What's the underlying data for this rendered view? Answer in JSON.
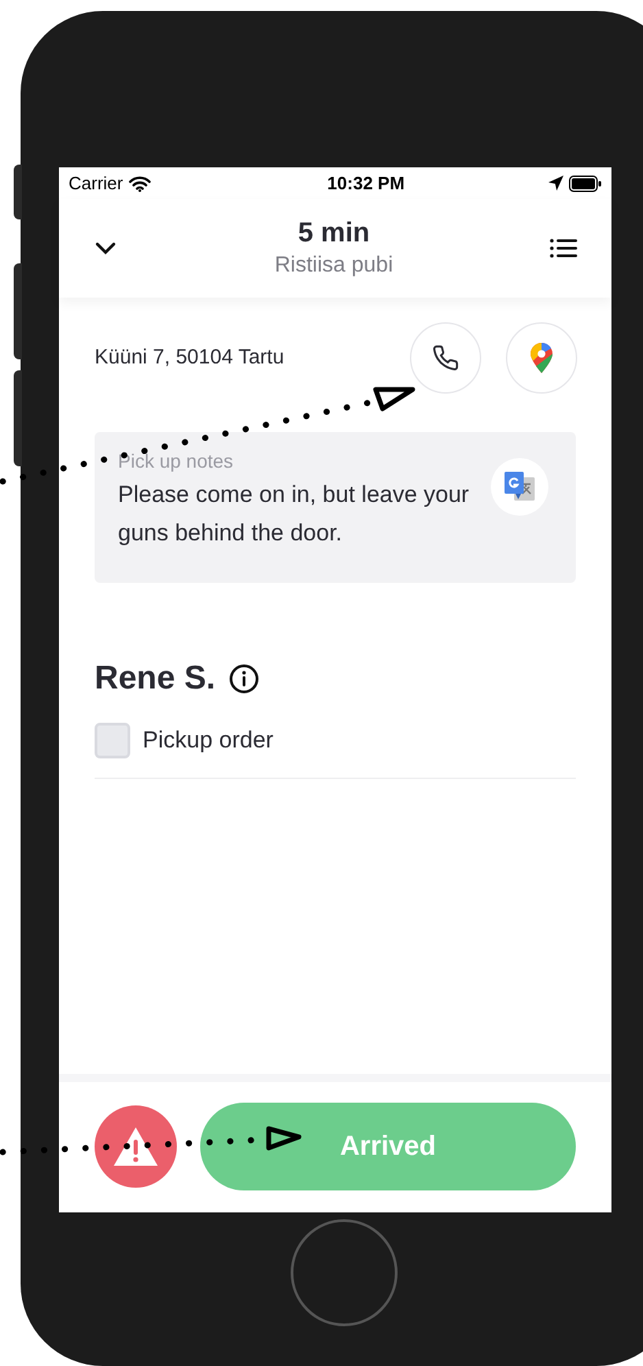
{
  "status_bar": {
    "carrier": "Carrier",
    "time": "10:32 PM"
  },
  "header": {
    "title": "5 min",
    "subtitle": "Ristiisa pubi"
  },
  "address": "Küüni 7, 50104 Tartu",
  "notes": {
    "label": "Pick up notes",
    "text": "Please come on in, but leave your guns behind the door."
  },
  "customer": {
    "name": "Rene S."
  },
  "checklist": [
    {
      "label": "Pickup order",
      "checked": false
    }
  ],
  "actions": {
    "arrived_button": "Arrived"
  }
}
